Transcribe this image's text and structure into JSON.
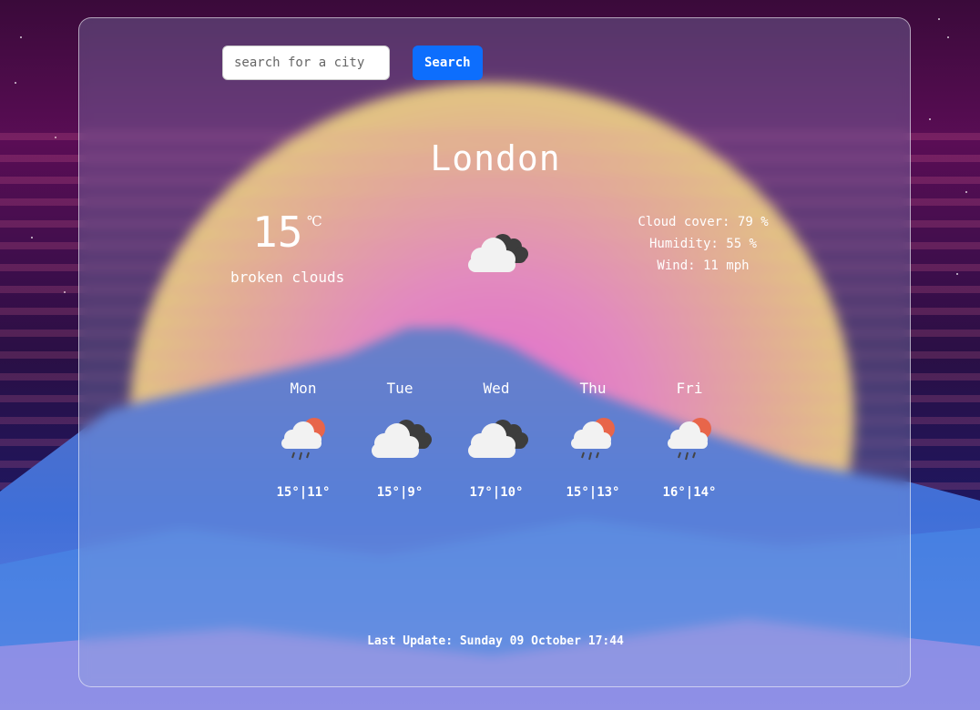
{
  "search": {
    "placeholder": "search for a city",
    "button_label": "Search"
  },
  "current": {
    "city": "London",
    "temperature": "15",
    "unit": "℃",
    "description": "broken clouds",
    "icon": "broken-clouds-icon",
    "cloud_cover": "Cloud cover: 79 %",
    "humidity": "Humidity: 55 %",
    "wind": "Wind: 11 mph"
  },
  "forecast": [
    {
      "day": "Mon",
      "range": "15°|11°",
      "icon": "rain-sun-icon"
    },
    {
      "day": "Tue",
      "range": "15°|9°",
      "icon": "broken-clouds-icon"
    },
    {
      "day": "Wed",
      "range": "17°|10°",
      "icon": "broken-clouds-icon"
    },
    {
      "day": "Thu",
      "range": "15°|13°",
      "icon": "rain-sun-icon"
    },
    {
      "day": "Fri",
      "range": "16°|14°",
      "icon": "rain-sun-icon"
    }
  ],
  "last_update": "Last Update: Sunday 09 October 17:44",
  "colors": {
    "accent": "#0d6efd",
    "sun": "#e8654a",
    "cloud_light": "#f2f2f2",
    "cloud_dark": "#444444"
  }
}
